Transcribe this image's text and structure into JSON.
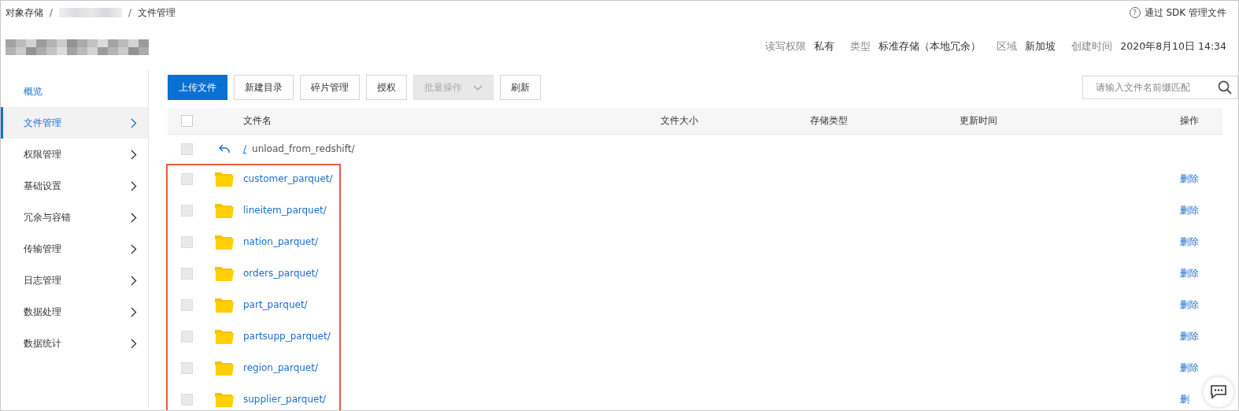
{
  "breadcrumb": [
    {
      "label": "对象存储"
    },
    {
      "label": "文件管理"
    }
  ],
  "breadcrumb_separators": [
    "/",
    "/"
  ],
  "help_icon": "?",
  "help_link": "通过 SDK 管理文件",
  "info": [
    {
      "label": "读写权限",
      "value": "私有"
    },
    {
      "label": "类型",
      "value": "标准存储（本地冗余）"
    },
    {
      "label": "区域",
      "value": "新加坡"
    },
    {
      "label": "创建时间",
      "value": "2020年8月10日 14:34"
    }
  ],
  "sidebar": {
    "items": [
      {
        "label": "概览",
        "kind": "link",
        "selected": false
      },
      {
        "label": "文件管理",
        "kind": "group",
        "selected": true
      },
      {
        "label": "权限管理",
        "kind": "group",
        "selected": false
      },
      {
        "label": "基础设置",
        "kind": "group",
        "selected": false
      },
      {
        "label": "冗余与容错",
        "kind": "group",
        "selected": false
      },
      {
        "label": "传输管理",
        "kind": "group",
        "selected": false
      },
      {
        "label": "日志管理",
        "kind": "group",
        "selected": false
      },
      {
        "label": "数据处理",
        "kind": "group",
        "selected": false
      },
      {
        "label": "数据统计",
        "kind": "group",
        "selected": false
      }
    ]
  },
  "toolbar": [
    {
      "label": "上传文件",
      "kind": "primary",
      "disabled": false
    },
    {
      "label": "新建目录",
      "kind": "default",
      "disabled": false
    },
    {
      "label": "碎片管理",
      "kind": "default",
      "disabled": false
    },
    {
      "label": "授权",
      "kind": "default",
      "disabled": false
    },
    {
      "label": "批量操作",
      "kind": "dropdown",
      "disabled": true
    },
    {
      "label": "刷新",
      "kind": "default",
      "disabled": false
    }
  ],
  "search": {
    "placeholder": "请输入文件名前缀匹配"
  },
  "table": {
    "columns": [
      "文件名",
      "文件大小",
      "存储类型",
      "更新时间",
      "操作"
    ],
    "header_checked": false,
    "parent_row": {
      "root": "/",
      "path": "unload_from_redshift/",
      "checked": false
    },
    "rows": [
      {
        "name": "customer_parquet/",
        "action": "删除",
        "checked": false
      },
      {
        "name": "lineitem_parquet/",
        "action": "删除",
        "checked": false
      },
      {
        "name": "nation_parquet/",
        "action": "删除",
        "checked": false
      },
      {
        "name": "orders_parquet/",
        "action": "删除",
        "checked": false
      },
      {
        "name": "part_parquet/",
        "action": "删除",
        "checked": false
      },
      {
        "name": "partsupp_parquet/",
        "action": "删除",
        "checked": false
      },
      {
        "name": "region_parquet/",
        "action": "删除",
        "checked": false
      },
      {
        "name": "supplier_parquet/",
        "action": "删",
        "checked": false
      }
    ]
  }
}
